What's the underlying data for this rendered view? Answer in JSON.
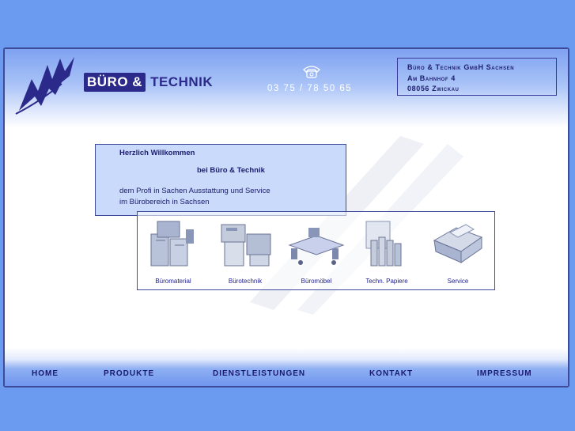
{
  "header": {
    "brand_part1": "BÜRO &",
    "brand_part2": "TECHNIK",
    "phone": "03 75 / 78 50 65",
    "phone_icon": "telephone-icon",
    "address": [
      "Büro & Technik GmbH Sachsen",
      "Am Bahnhof 4",
      "08056 Zwickau"
    ]
  },
  "welcome": {
    "line1": "Herzlich Willkommen",
    "line2": "bei Büro & Technik",
    "line3": "dem Profi in Sachen Ausstattung und Service",
    "line4": "im Bürobereich in Sachsen"
  },
  "products": [
    {
      "label": "Büromaterial",
      "icon": "office-supplies-icon"
    },
    {
      "label": "Bürotechnik",
      "icon": "office-machines-icon"
    },
    {
      "label": "Büromöbel",
      "icon": "office-furniture-icon"
    },
    {
      "label": "Techn. Papiere",
      "icon": "paper-rolls-icon"
    },
    {
      "label": "Service",
      "icon": "service-printer-icon"
    }
  ],
  "nav": [
    "HOME",
    "PRODUKTE",
    "DIENSTLEISTUNGEN",
    "KONTAKT",
    "IMPRESSUM"
  ]
}
